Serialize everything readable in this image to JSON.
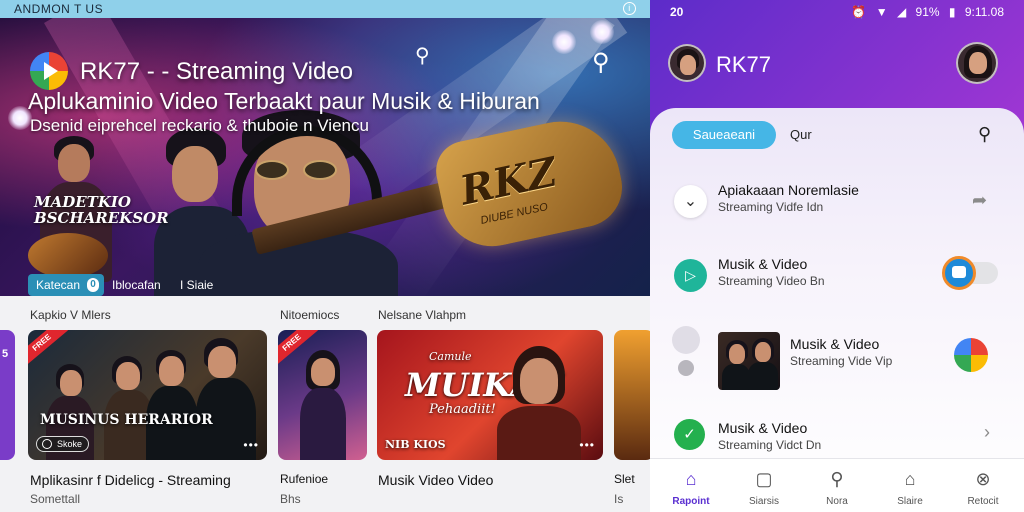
{
  "left": {
    "status_text": "ANDMON T US",
    "info_icon": "info-icon",
    "hero": {
      "title": "RK77 - - Streaming Video",
      "subtitle": "Aplukaminio Video Terbaakt paur Musik & Hiburan",
      "caption": "Dsenid eiprehcel reckario & thuboie n Viencu",
      "side_text_line1": "MADETKIO",
      "side_text_line2": "BSCHAREKSOR",
      "guitar_logo": "RKZ",
      "guitar_sub": "DIUBE NUSO",
      "chip_label": "Katecan",
      "chip_count": "0",
      "chip_text_1": "Iblocafan",
      "chip_text_2": "I Siaie"
    },
    "row_labels": [
      "Kapkio V Mlers",
      "Nitoemiocs",
      "Nelsane Vlahpm"
    ],
    "cards": [
      {
        "overlay": "MUSINUS HERARIOR",
        "badge": "Skoke",
        "dots": "•••",
        "tag": "FREE",
        "title": "Mplikasinr f Didelicg - Streaming",
        "sub": "Somettall"
      },
      {
        "overlay": "",
        "badge": "",
        "dots": "",
        "tag": "FREE",
        "title": "Rufenioe",
        "sub": "Bhs"
      },
      {
        "overlay": "MUIKAN",
        "overlay2": "Pehaadiit!",
        "overlay_top": "Camule",
        "badge": "NIB KIOS",
        "dots": "•••",
        "tag": "",
        "title": "Musik Video Video",
        "sub": ""
      },
      {
        "overlay": "",
        "badge": "",
        "dots": "",
        "tag": "",
        "title": "Slet",
        "sub": "Is"
      }
    ],
    "left_card_marker": "5"
  },
  "right": {
    "status_left": "20",
    "status_right": {
      "alarm": "alarm-icon",
      "wifi": "wifi-icon",
      "signal": "signal-icon",
      "battery": "91%",
      "time": "9:11.08"
    },
    "title": "RK77",
    "pill": "Saueaeani",
    "pill_after": "Qur",
    "list": [
      {
        "title": "Apiakaaan Noremlasie",
        "sub": "Streaming Vidfe Idn",
        "icon": "chevron-down-icon",
        "trailing": "share-icon"
      },
      {
        "title": "Musik & Video",
        "sub": "Streaming Video Bn",
        "icon": "play-icon",
        "trailing": "toggle-switch"
      },
      {
        "title": "Musik & Video",
        "sub": "Streaming Vide Vip",
        "icon": "more-icon",
        "trailing": "colorful-app-icon"
      },
      {
        "title": "Musik & Video",
        "sub": "Streaming Vidct Dn",
        "icon": "check-icon",
        "trailing": "chevron-right-icon"
      }
    ],
    "nav": [
      {
        "label": "Rapoint",
        "icon": "home-icon",
        "active": true
      },
      {
        "label": "Siarsis",
        "icon": "square-icon",
        "active": false
      },
      {
        "label": "Nora",
        "icon": "search-icon",
        "active": false
      },
      {
        "label": "Slaire",
        "icon": "house-outline-icon",
        "active": false
      },
      {
        "label": "Retocit",
        "icon": "close-circle-icon",
        "active": false
      }
    ]
  },
  "colors": {
    "accent": "#5a2fd1",
    "pill": "#45b6e6",
    "chip": "#2b8fb6",
    "tag_red": "#e0262e",
    "header_gradient_start": "#5c2cc9",
    "header_gradient_end": "#d24aa8",
    "status_bar": "#8fd0ea"
  }
}
